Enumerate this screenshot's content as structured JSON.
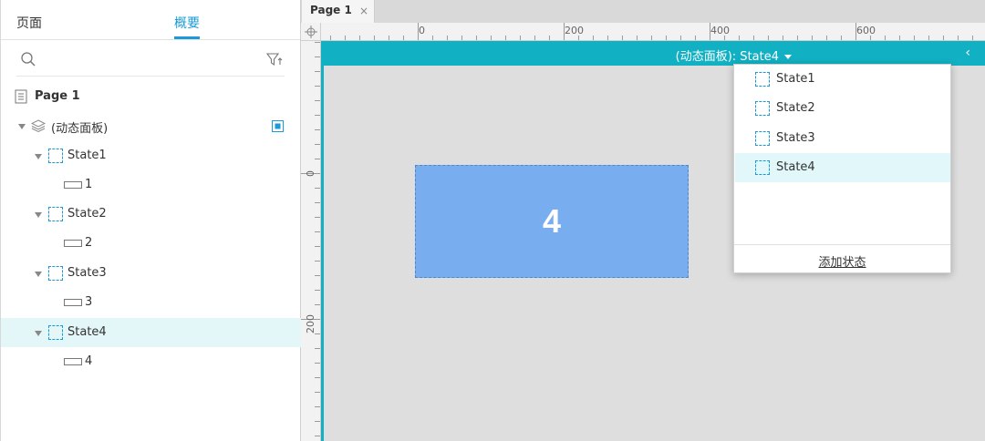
{
  "left_panel": {
    "tabs": [
      {
        "label": "页面"
      },
      {
        "label": "概要",
        "active": true
      }
    ],
    "tree": {
      "page": "Page 1",
      "dynamic_panel": "(动态面板)",
      "states": [
        {
          "label": "State1",
          "child": "1"
        },
        {
          "label": "State2",
          "child": "2"
        },
        {
          "label": "State3",
          "child": "3"
        },
        {
          "label": "State4",
          "child": "4",
          "selected": true
        }
      ]
    }
  },
  "editor": {
    "tab": {
      "label": "Page 1",
      "close": "×"
    },
    "ruler_top": [
      "0",
      "200",
      "400",
      "600"
    ],
    "ruler_left": [
      "0",
      "200"
    ],
    "dynamic_panel_header": {
      "title": "(动态面板): State4",
      "collapse": "‹"
    },
    "widget_text": "4"
  },
  "dropdown": {
    "items": [
      "State1",
      "State2",
      "State3",
      "State4"
    ],
    "selected": "State4",
    "add_label": "添加状态"
  },
  "colors": {
    "accent": "#1a9bd7",
    "panel_header": "#12b0c3",
    "selected_row": "#e3f6f8",
    "widget_fill": "#78aef0"
  }
}
